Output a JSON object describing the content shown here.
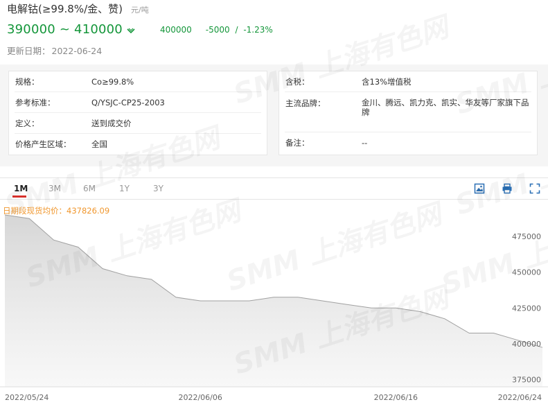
{
  "header": {
    "title": "电解钴(≥99.8%/金、赞)",
    "unit": "元/吨",
    "price_range": "390000 ~ 410000",
    "average": "400000",
    "change": "-5000",
    "separator": "/",
    "change_pct": "-1.23%",
    "update_label": "更新日期：",
    "update_date": "2022-06-24",
    "trend_icon": "down-arrow-icon"
  },
  "info_left": [
    {
      "label": "规格：",
      "value": "Co≥99.8%"
    },
    {
      "label": "参考标准：",
      "value": "Q/YSJC-CP25-2003"
    },
    {
      "label": "定义：",
      "value": "送到成交价"
    },
    {
      "label": "价格产生区域：",
      "value": "全国"
    }
  ],
  "info_right": [
    {
      "label": "含税：",
      "value": "含13%增值税"
    },
    {
      "label": "主流品牌：",
      "value": "金川、腾远、凯力克、凯实、华友等厂家旗下品牌"
    },
    {
      "label": "备注：",
      "value": "--"
    }
  ],
  "tabs": [
    {
      "label": "1M",
      "active": true
    },
    {
      "label": "3M",
      "active": false
    },
    {
      "label": "6M",
      "active": false
    },
    {
      "label": "1Y",
      "active": false
    },
    {
      "label": "3Y",
      "active": false
    }
  ],
  "tools": [
    "image-download-icon",
    "print-icon",
    "fullscreen-icon"
  ],
  "watermark": "SMM 上海有色网",
  "colors": {
    "price_green": "#14963a",
    "avg_orange": "#f0972e",
    "active_tab_red": "#d6302b",
    "line": "#a0a0a0"
  },
  "chart_data": {
    "type": "area",
    "legend_label": "日期段现货均价：437826.09",
    "x": [
      "2022-05-24",
      "2022-05-25",
      "2022-05-26",
      "2022-05-27",
      "2022-05-30",
      "2022-05-31",
      "2022-06-01",
      "2022-06-02",
      "2022-06-06",
      "2022-06-07",
      "2022-06-08",
      "2022-06-09",
      "2022-06-10",
      "2022-06-13",
      "2022-06-14",
      "2022-06-15",
      "2022-06-16",
      "2022-06-17",
      "2022-06-20",
      "2022-06-21",
      "2022-06-22",
      "2022-06-23",
      "2022-06-24"
    ],
    "values": [
      490000,
      487500,
      472500,
      467500,
      452500,
      447500,
      445000,
      432500,
      430000,
      430000,
      430000,
      432500,
      432500,
      430000,
      427500,
      425000,
      425000,
      422500,
      417500,
      407500,
      407500,
      402500,
      397500
    ],
    "x_tick_labels": [
      "2022/05/24",
      "2022/06/06",
      "2022/06/16",
      "2022/06/24"
    ],
    "x_tick_indices": [
      0,
      8,
      16,
      22
    ],
    "ylim": [
      370000,
      490000
    ],
    "y_ticks": [
      "475000",
      "450000",
      "425000",
      "400000",
      "375000"
    ],
    "y_tick_values": [
      475000,
      450000,
      425000,
      400000,
      375000
    ],
    "grid": false
  }
}
